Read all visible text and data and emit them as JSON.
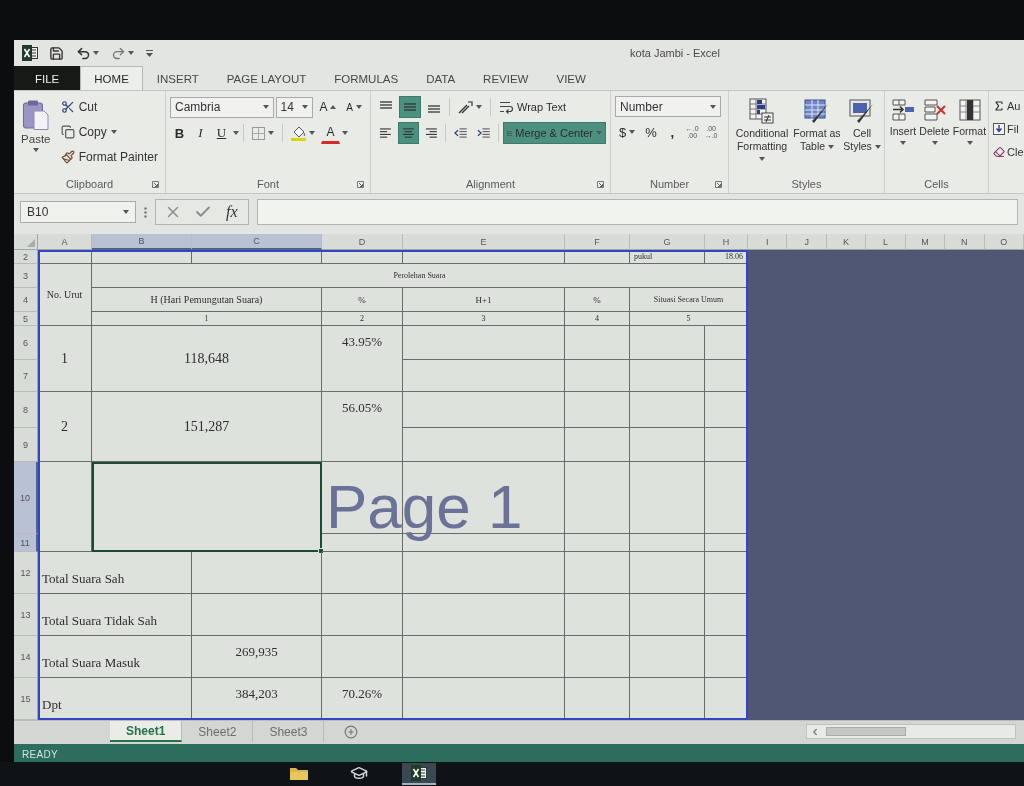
{
  "window": {
    "title": "kota Jambi - Excel"
  },
  "ribbon_tabs": [
    {
      "label": "FILE",
      "kind": "file",
      "selected": false
    },
    {
      "label": "HOME",
      "kind": "tab",
      "selected": true
    },
    {
      "label": "INSERT",
      "kind": "tab",
      "selected": false
    },
    {
      "label": "PAGE LAYOUT",
      "kind": "tab",
      "selected": false
    },
    {
      "label": "FORMULAS",
      "kind": "tab",
      "selected": false
    },
    {
      "label": "DATA",
      "kind": "tab",
      "selected": false
    },
    {
      "label": "REVIEW",
      "kind": "tab",
      "selected": false
    },
    {
      "label": "VIEW",
      "kind": "tab",
      "selected": false
    }
  ],
  "ribbon": {
    "clipboard": {
      "title": "Clipboard",
      "paste": "Paste",
      "cut": "Cut",
      "copy": "Copy",
      "format_painter": "Format Painter"
    },
    "font": {
      "title": "Font",
      "font_name": "Cambria",
      "font_size": "14",
      "grow": "A",
      "shrink": "A",
      "style_buttons": [
        "B",
        "I",
        "U"
      ],
      "font_color": "A"
    },
    "alignment": {
      "title": "Alignment",
      "vertical": [
        {
          "selected": false
        },
        {
          "selected": true
        },
        {
          "selected": false
        }
      ],
      "horizontal": [
        {
          "selected": false
        },
        {
          "selected": true
        },
        {
          "selected": false
        }
      ],
      "wrap_text": {
        "label": "Wrap Text",
        "selected": false
      },
      "merge_center": {
        "label": "Merge & Center",
        "selected": true
      }
    },
    "number": {
      "title": "Number",
      "format": "Number",
      "currency": "$",
      "percent": "%",
      "comma": ",",
      "decimals": [
        {
          "top": "←.0",
          "bottom": ".00"
        },
        {
          "top": ".00",
          "bottom": "→.0"
        }
      ]
    },
    "styles": {
      "title": "Styles",
      "buttons": [
        "Conditional Formatting",
        "Format as Table",
        "Cell Styles"
      ]
    },
    "cells": {
      "title": "Cells",
      "buttons": [
        "Insert",
        "Delete",
        "Format"
      ]
    },
    "editing": {
      "buttons": [
        "Au",
        "Fil",
        "Cle"
      ]
    }
  },
  "formula_bar": {
    "name_box": "B10",
    "function_label": "fx"
  },
  "sheet": {
    "column_headers": [
      {
        "label": "A",
        "selected": false
      },
      {
        "label": "B",
        "selected": true
      },
      {
        "label": "C",
        "selected": true
      },
      {
        "label": "D",
        "selected": false
      },
      {
        "label": "E",
        "selected": false
      },
      {
        "label": "F",
        "selected": false
      },
      {
        "label": "G",
        "selected": false
      },
      {
        "label": "H",
        "selected": false
      },
      {
        "label": "I",
        "selected": false
      },
      {
        "label": "J",
        "selected": false
      },
      {
        "label": "K",
        "selected": false
      },
      {
        "label": "L",
        "selected": false
      },
      {
        "label": "M",
        "selected": false
      },
      {
        "label": "N",
        "selected": false
      },
      {
        "label": "O",
        "selected": false
      }
    ],
    "row_headers": [
      {
        "label": "2",
        "selected": false
      },
      {
        "label": "3",
        "selected": false
      },
      {
        "label": "4",
        "selected": false
      },
      {
        "label": "5",
        "selected": false
      },
      {
        "label": "6",
        "selected": false
      },
      {
        "label": "7",
        "selected": false
      },
      {
        "label": "8",
        "selected": false
      },
      {
        "label": "9",
        "selected": false
      },
      {
        "label": "10",
        "selected": true
      },
      {
        "label": "11",
        "selected": true
      },
      {
        "label": "12",
        "selected": false
      },
      {
        "label": "13",
        "selected": false
      },
      {
        "label": "14",
        "selected": false
      },
      {
        "label": "15",
        "selected": false
      }
    ],
    "time_label": "pukul",
    "time": "18.06",
    "no_urut": "No. Urut",
    "group_title": "Perolehan Suara",
    "columns": [
      {
        "label": "H (Hari Pemungutan Suara)",
        "index": "1"
      },
      {
        "label": "%",
        "index": "2"
      },
      {
        "label": "H+1",
        "index": "3"
      },
      {
        "label": "%",
        "index": "4"
      },
      {
        "label": "Situasi Secara Umum",
        "index": "5"
      }
    ],
    "entries": [
      {
        "number": "1",
        "votes": "118,648",
        "percent": "43.95%"
      },
      {
        "number": "2",
        "votes": "151,287",
        "percent": "56.05%"
      }
    ],
    "empty_rows": [
      {
        "selected": true
      }
    ],
    "totals": [
      {
        "label": "Total Suara Sah"
      },
      {
        "label": "Total Suara Tidak Sah"
      },
      {
        "label": "Total Suara Masuk",
        "votes": "269,935"
      },
      {
        "label": "Dpt",
        "votes": "384,203",
        "percent": "70.26%"
      }
    ],
    "page_label": "Page 1"
  },
  "sheet_tabs": [
    {
      "label": "Sheet1",
      "selected": true
    },
    {
      "label": "Sheet2",
      "selected": false
    },
    {
      "label": "Sheet3",
      "selected": false
    }
  ],
  "status_bar": {
    "text": "READY"
  },
  "taskbar": {
    "apps": [
      {
        "kind": "folder",
        "selected": false
      },
      {
        "kind": "cap",
        "selected": false
      },
      {
        "kind": "spreadsheet",
        "selected": true
      }
    ]
  }
}
